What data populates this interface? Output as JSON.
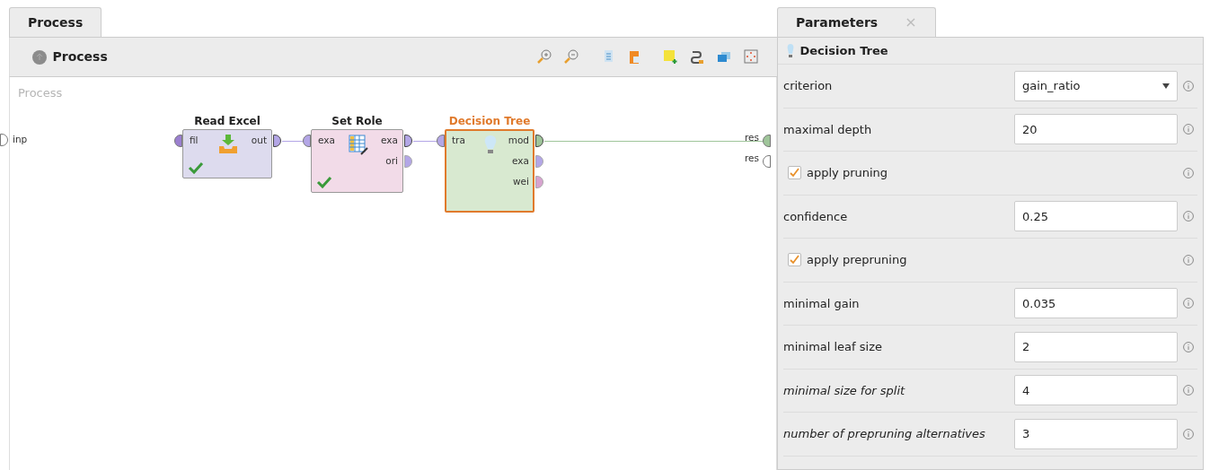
{
  "process_panel": {
    "tab": {
      "label": "Process",
      "selected": true
    },
    "breadcrumb": "Process",
    "canvas_title": "Process",
    "input_ports": [
      {
        "label": "inp",
        "connected": false
      }
    ],
    "operators": [
      {
        "name": "Read Excel",
        "kind": "read",
        "selected": false,
        "ok": true,
        "inputs": [
          {
            "label": "fil",
            "color": "#9b7fd0"
          }
        ],
        "outputs": [
          {
            "label": "out",
            "color": "#b3a6e6",
            "connected": true
          }
        ]
      },
      {
        "name": "Set Role",
        "kind": "role",
        "selected": false,
        "ok": true,
        "inputs": [
          {
            "label": "exa",
            "color": "#b3a6e6"
          }
        ],
        "outputs": [
          {
            "label": "exa",
            "color": "#b3a6e6",
            "connected": true
          },
          {
            "label": "ori",
            "color": "#b3a6e6",
            "connected": false
          }
        ]
      },
      {
        "name": "Decision Tree",
        "kind": "tree",
        "selected": true,
        "ok": false,
        "inputs": [
          {
            "label": "tra",
            "color": "#b3a6e6"
          }
        ],
        "outputs": [
          {
            "label": "mod",
            "color": "#9fc59a",
            "connected": true
          },
          {
            "label": "exa",
            "color": "#b3a6e6",
            "connected": false
          },
          {
            "label": "wei",
            "color": "#d7a3cf",
            "connected": false
          }
        ]
      }
    ],
    "result_ports": [
      {
        "label": "res",
        "connected": true
      },
      {
        "label": "res",
        "connected": false
      }
    ]
  },
  "parameters_panel": {
    "tab": {
      "label": "Parameters",
      "selected": true
    },
    "close": "×",
    "operator": "Decision Tree",
    "params": [
      {
        "kind": "select",
        "label": "criterion",
        "value": "gain_ratio",
        "italic": false
      },
      {
        "kind": "text",
        "label": "maximal depth",
        "value": "20",
        "italic": false
      },
      {
        "kind": "checkbox",
        "label": "apply pruning",
        "checked": true,
        "italic": false
      },
      {
        "kind": "text",
        "label": "confidence",
        "value": "0.25",
        "italic": false
      },
      {
        "kind": "checkbox",
        "label": "apply prepruning",
        "checked": true,
        "italic": false
      },
      {
        "kind": "text",
        "label": "minimal gain",
        "value": "0.035",
        "italic": false
      },
      {
        "kind": "text",
        "label": "minimal leaf size",
        "value": "2",
        "italic": false
      },
      {
        "kind": "text",
        "label": "minimal size for split",
        "value": "4",
        "italic": true
      },
      {
        "kind": "text",
        "label": "number of prepruning alternatives",
        "value": "3",
        "italic": true
      }
    ]
  }
}
